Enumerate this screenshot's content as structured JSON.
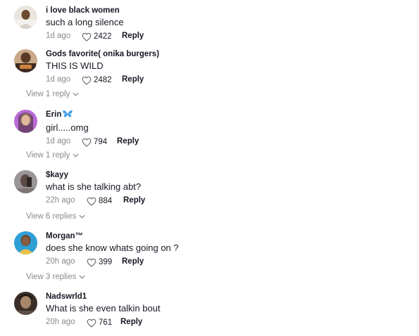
{
  "comments": [
    {
      "username": "i love black women",
      "text": "such a long silence",
      "time": "1d ago",
      "likes": "2422",
      "reply_label": "Reply",
      "view_replies": ""
    },
    {
      "username": "Gods favorite( onika burgers)",
      "text": "THIS IS WILD",
      "time": "1d ago",
      "likes": "2482",
      "reply_label": "Reply",
      "view_replies": "View 1 reply"
    },
    {
      "username": "Erin",
      "username_emoji": "butterfly-icon",
      "text": "girl.....omg",
      "time": "1d ago",
      "likes": "794",
      "reply_label": "Reply",
      "view_replies": "View 1 reply"
    },
    {
      "username": "$kayy",
      "text": "what is she talking abt?",
      "time": "22h ago",
      "likes": "884",
      "reply_label": "Reply",
      "view_replies": "View 6 replies"
    },
    {
      "username": "Morgan™",
      "text": "does she know whats going on ?",
      "time": "20h ago",
      "likes": "399",
      "reply_label": "Reply",
      "view_replies": "View 3 replies"
    },
    {
      "username": "Nadswrld1",
      "text": "What is she even talkin bout",
      "time": "20h ago",
      "likes": "761",
      "reply_label": "Reply",
      "view_replies": ""
    }
  ],
  "icons": {
    "like": "heart-outline-icon",
    "expand": "chevron-down-icon"
  },
  "colors": {
    "text_primary": "#161823",
    "text_secondary": "#8a8b91",
    "butterfly": "#4aa3e8"
  }
}
